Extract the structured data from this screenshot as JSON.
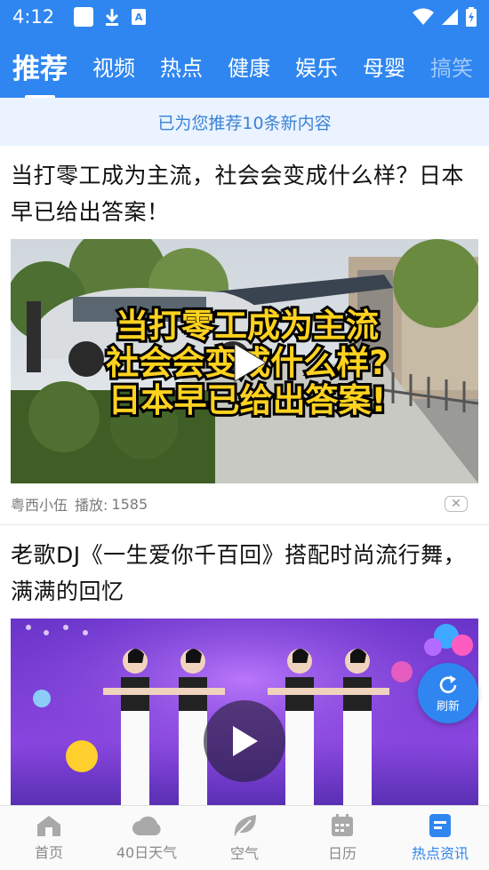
{
  "status_bar": {
    "time": "4:12",
    "icons": [
      "notification-square-icon",
      "download-icon",
      "a-box-icon",
      "wifi-icon",
      "signal-icon",
      "battery-charging-icon"
    ]
  },
  "tabs": [
    {
      "label": "推荐",
      "active": true
    },
    {
      "label": "视频",
      "active": false
    },
    {
      "label": "热点",
      "active": false
    },
    {
      "label": "健康",
      "active": false
    },
    {
      "label": "娱乐",
      "active": false
    },
    {
      "label": "母婴",
      "active": false
    },
    {
      "label": "搞笑",
      "active": false
    }
  ],
  "banner": {
    "text": "已为您推荐10条新内容"
  },
  "feed": [
    {
      "title": "当打零工成为主流，社会会变成什么样？日本早已给出答案！",
      "thumbnail_caption": [
        "当打零工成为主流",
        "社会会变成什么样?",
        "日本早已给出答案!"
      ],
      "author": "粤西小伍",
      "plays_label": "播放:",
      "plays": "1585"
    },
    {
      "title": "老歌DJ《一生爱你千百回》搭配时尚流行舞，满满的回忆"
    }
  ],
  "refresh_button": {
    "label": "刷新"
  },
  "bottom_nav": [
    {
      "label": "首页",
      "icon": "home-icon",
      "active": false
    },
    {
      "label": "40日天气",
      "icon": "cloud-icon",
      "active": false
    },
    {
      "label": "空气",
      "icon": "leaf-icon",
      "active": false
    },
    {
      "label": "日历",
      "icon": "calendar-icon",
      "active": false
    },
    {
      "label": "热点资讯",
      "icon": "news-icon",
      "active": true
    }
  ],
  "colors": {
    "primary": "#2f86f0",
    "banner_bg": "#eaf3ff",
    "banner_text": "#3b82d6",
    "caption_yellow": "#ffd21f"
  }
}
